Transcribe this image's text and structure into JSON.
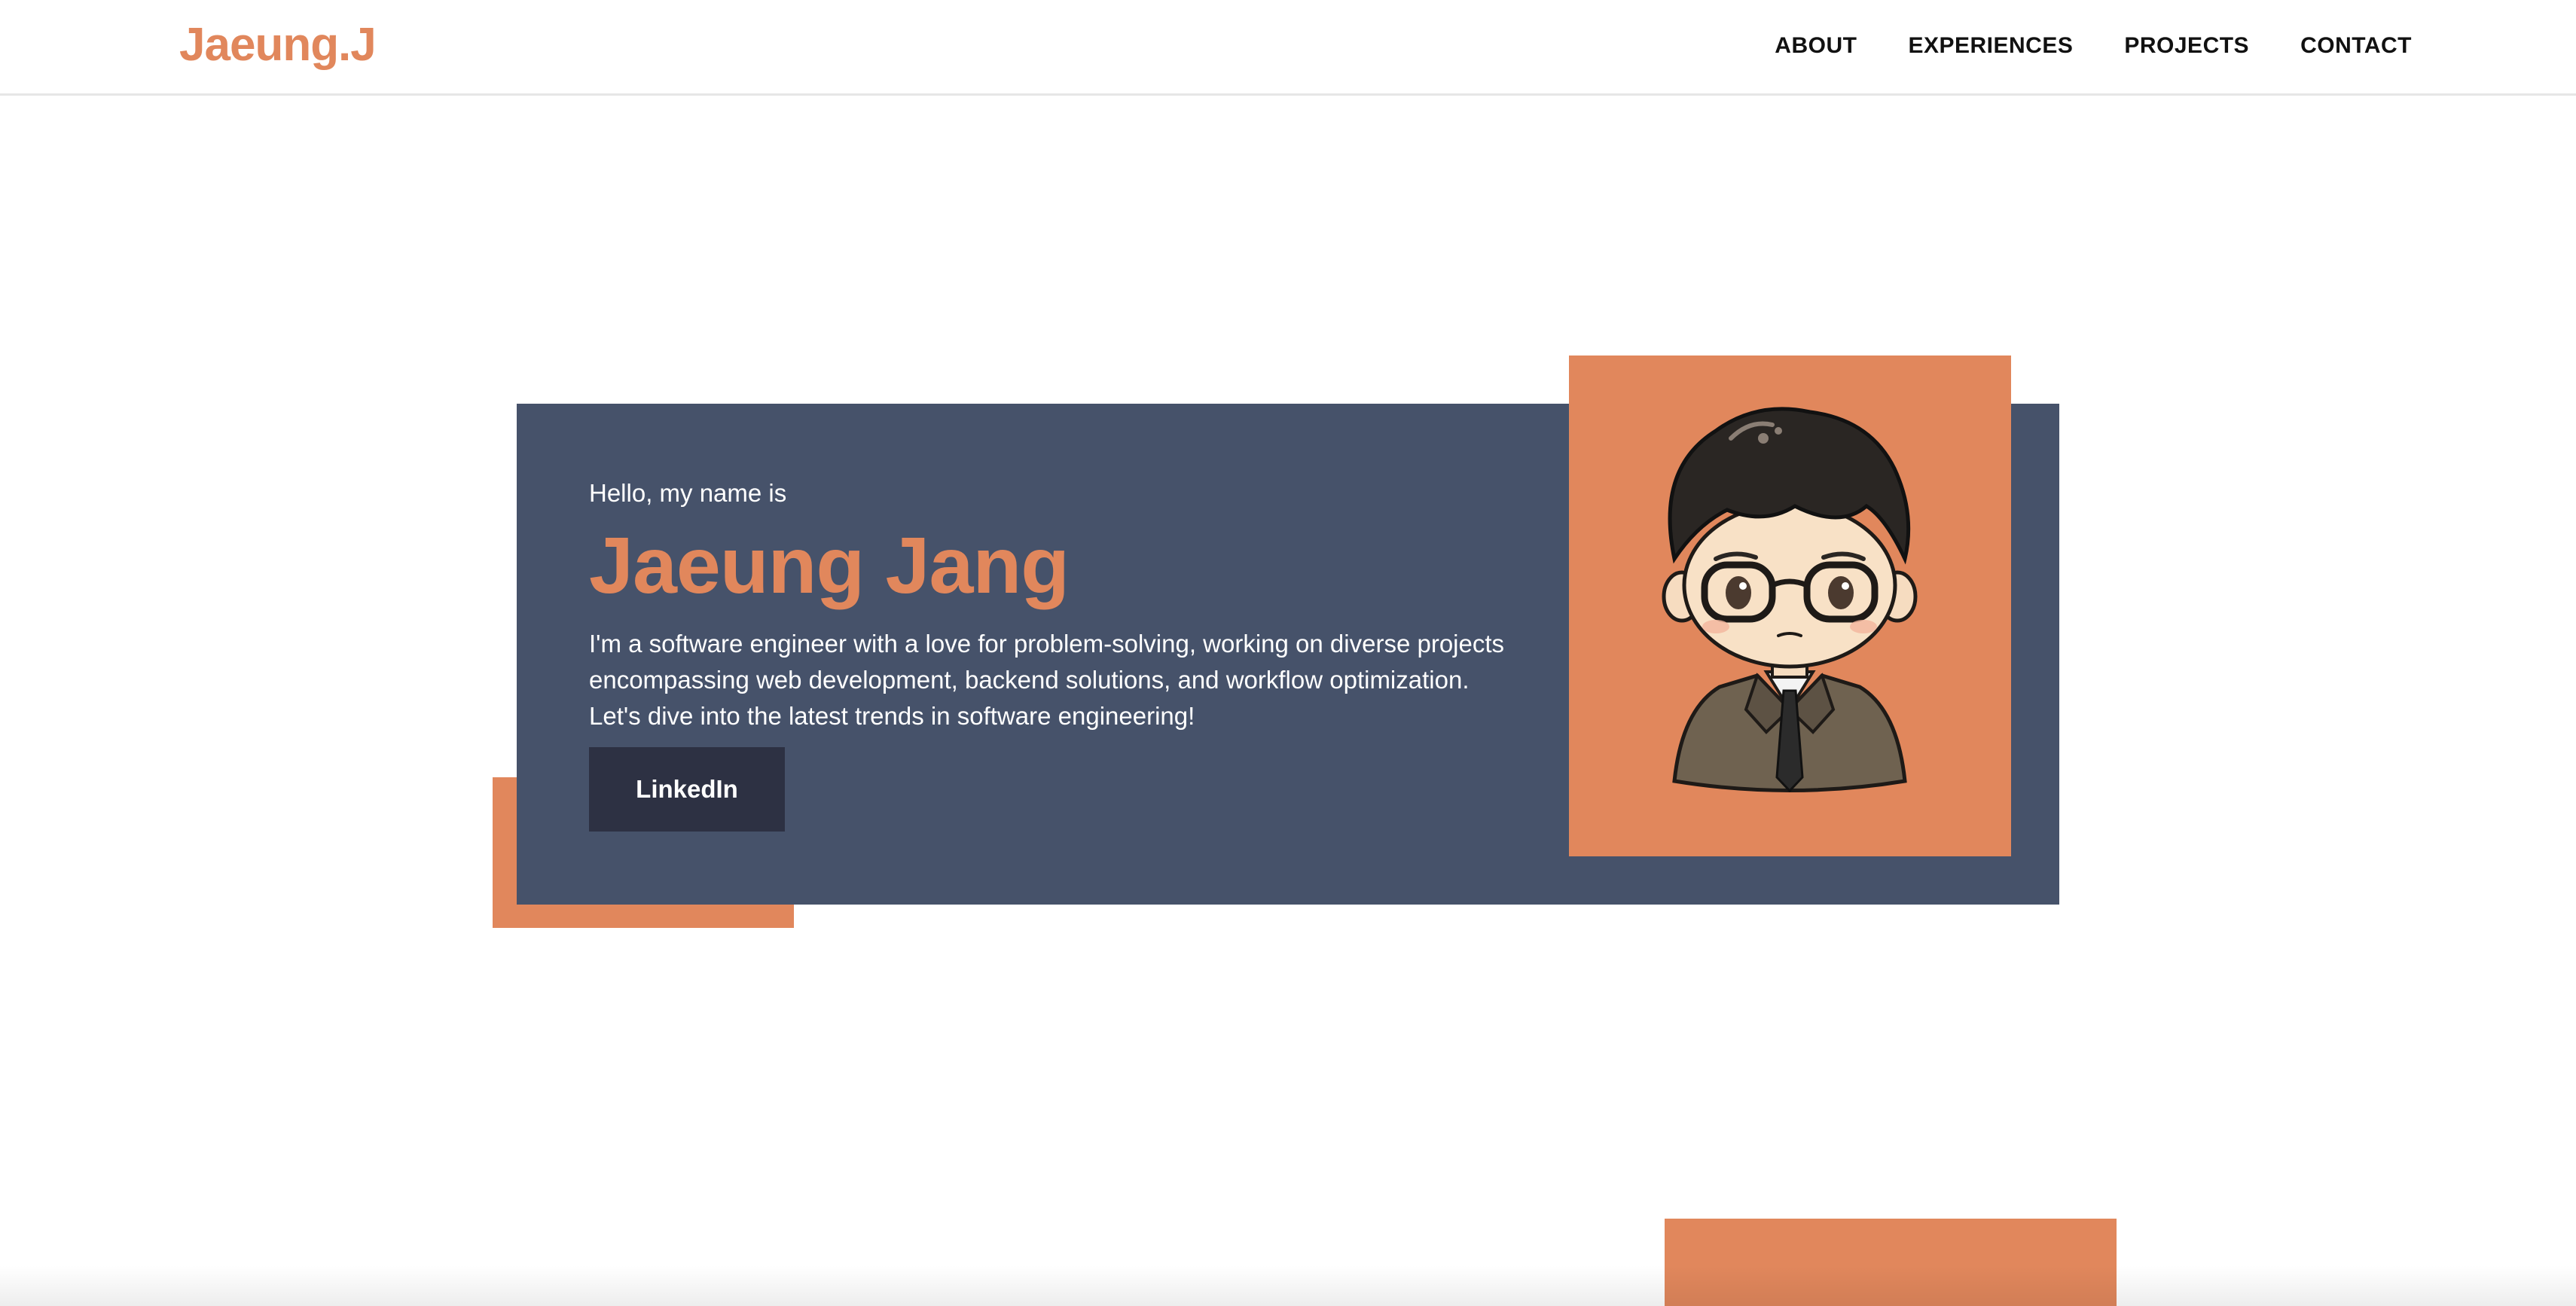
{
  "header": {
    "logo": "Jaeung.J",
    "nav": [
      {
        "label": "ABOUT"
      },
      {
        "label": "EXPERIENCES"
      },
      {
        "label": "PROJECTS"
      },
      {
        "label": "CONTACT"
      }
    ]
  },
  "hero": {
    "greeting": "Hello, my name is",
    "name": "Jaeung Jang",
    "description": "I'm a software engineer with a love for problem-solving, working on diverse projects encompassing web development, backend solutions, and workflow optimization. Let's dive into the latest trends in software engineering!",
    "button_label": "LinkedIn",
    "portrait_icon": "cartoon-avatar"
  },
  "colors": {
    "accent": "#e1875c",
    "card": "#46526a",
    "button": "#2d3143",
    "background": "#ffffff"
  }
}
